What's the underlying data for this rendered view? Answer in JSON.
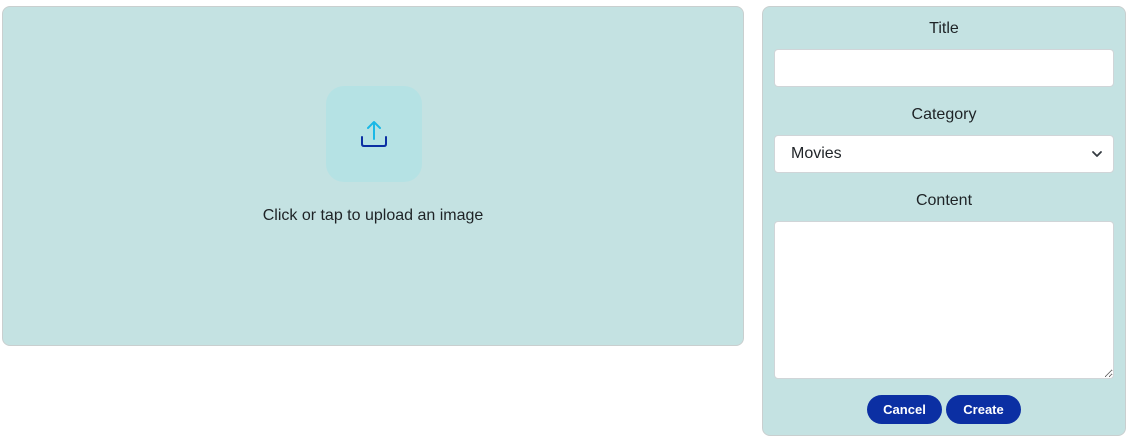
{
  "upload": {
    "prompt": "Click or tap to upload an image",
    "icon": "upload-icon",
    "arrow_color": "#1ab8e6",
    "tray_color": "#0b2fa3"
  },
  "form": {
    "title_label": "Title",
    "title_value": "",
    "category_label": "Category",
    "category_selected": "Movies",
    "content_label": "Content",
    "content_value": "",
    "cancel_label": "Cancel",
    "create_label": "Create"
  },
  "colors": {
    "panel_background": "#c4e2e2",
    "button_background": "#0b2fa3",
    "button_text": "#ffffff"
  }
}
